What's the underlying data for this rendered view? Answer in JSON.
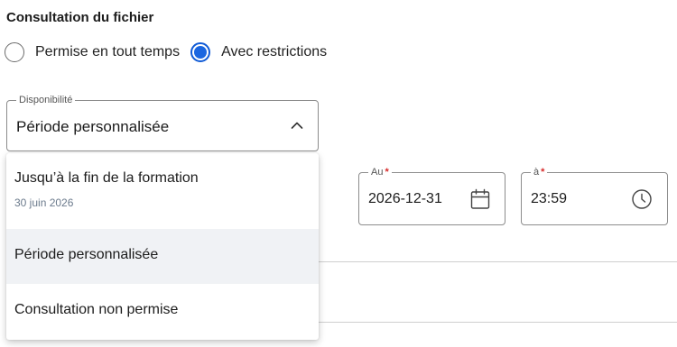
{
  "section": {
    "title": "Consultation du fichier"
  },
  "access": {
    "options": [
      {
        "label": "Permise en tout temps",
        "checked": false
      },
      {
        "label": "Avec restrictions",
        "checked": true
      }
    ]
  },
  "availability": {
    "label": "Disponibilité",
    "value": "Période personnalisée",
    "options": [
      {
        "label": "Jusqu’à la fin de la formation",
        "sublabel": "30 juin 2026"
      },
      {
        "label": "Période personnalisée",
        "highlighted": true
      },
      {
        "label": "Consultation non permise"
      }
    ]
  },
  "end_date": {
    "label": "Au",
    "required_mark": "*",
    "value": "2026-12-31",
    "icon": "calendar-icon"
  },
  "end_time": {
    "label": "à",
    "required_mark": "*",
    "value": "23:59",
    "icon": "clock-icon"
  },
  "colors": {
    "accent": "#1a66e0",
    "required": "#d62828",
    "highlight": "#f0f2f5"
  }
}
